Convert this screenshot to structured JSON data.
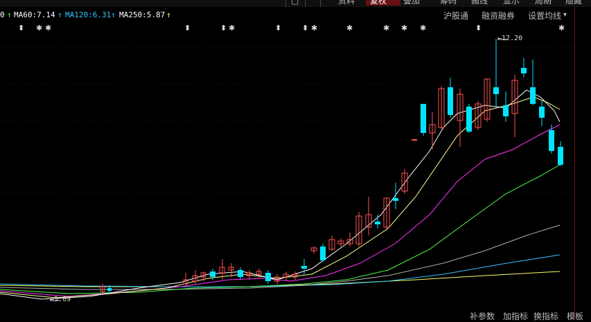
{
  "top_tabs": [
    "资料",
    "复权",
    "叠加",
    "筹码",
    "画线",
    "显示",
    "周期",
    "隐藏"
  ],
  "active_tab": "复权",
  "ma": [
    {
      "label": "MA60:7.14",
      "color": "#4cff4c",
      "arrow": "↑"
    },
    {
      "label": "MA120:6.31",
      "color": "#33c4ff",
      "arrow": "↑"
    },
    {
      "label": "MA250:5.87",
      "color": "#ffff66",
      "arrow": "↑"
    }
  ],
  "right_tabs": [
    "沪股通",
    "融资融券",
    "设置均线"
  ],
  "dropdown_glyph": "▾",
  "high_label": "12.20",
  "low_label": "5.09",
  "markers": [
    "⬍",
    "✱",
    "✱",
    "⬍",
    "⬍",
    "✱",
    "⬍",
    "⬍",
    "✱",
    "✱",
    "✱",
    "✱",
    "✱",
    "⬍",
    "✱"
  ],
  "bottom_tabs": [
    "补参数",
    "加指标",
    "换指标",
    "模板"
  ],
  "chart_data": {
    "type": "candlestick",
    "high": 12.2,
    "low": 5.09,
    "moving_averages": [
      {
        "name": "MA60",
        "value": 7.14
      },
      {
        "name": "MA120",
        "value": 6.31
      },
      {
        "name": "MA250",
        "value": 5.87
      }
    ]
  }
}
